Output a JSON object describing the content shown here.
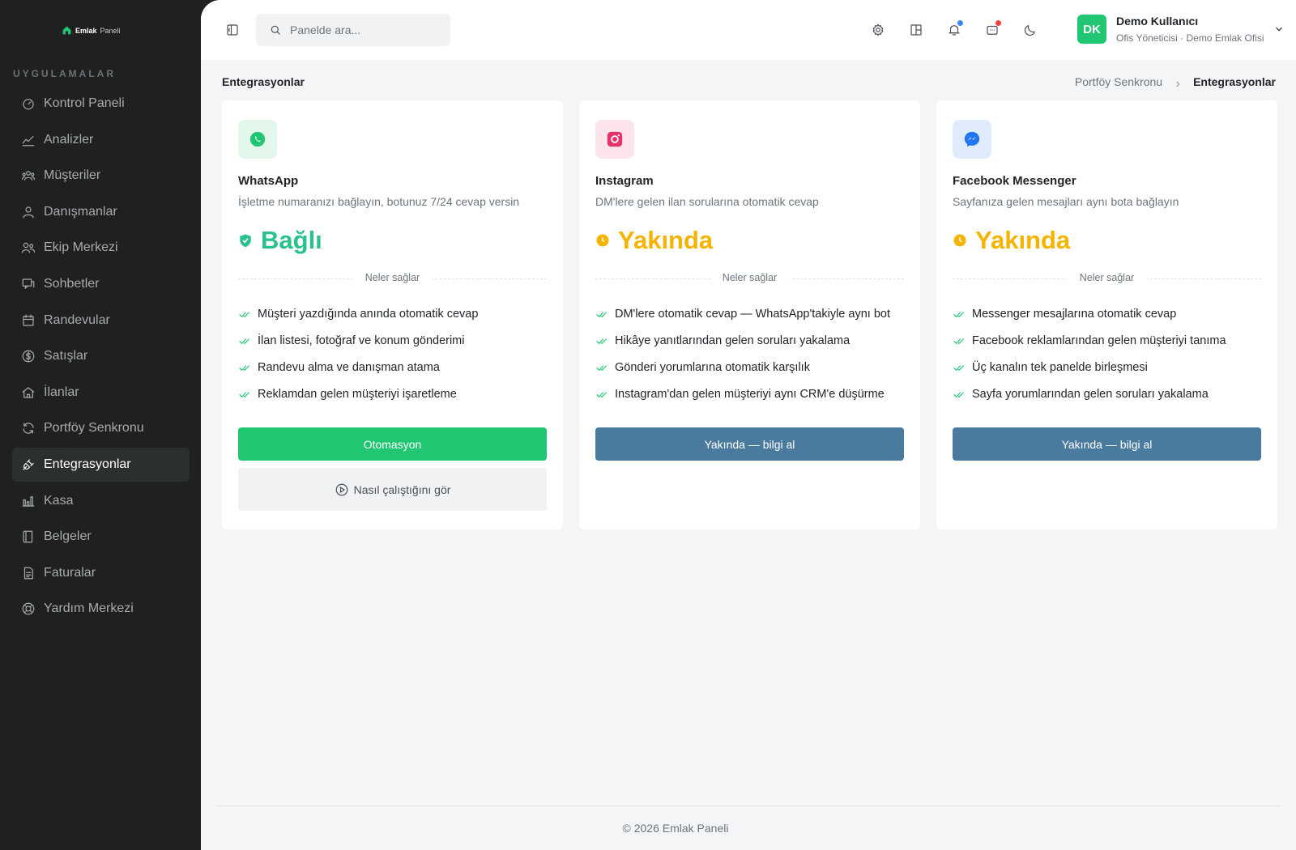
{
  "brand": {
    "name": "Emlak",
    "sub": "Paneli"
  },
  "sidebar": {
    "section_title": "UYGULAMALAR",
    "items": [
      {
        "label": "Kontrol Paneli",
        "icon": "dashboard-icon"
      },
      {
        "label": "Analizler",
        "icon": "chart-line-icon"
      },
      {
        "label": "Müşteriler",
        "icon": "users-icon"
      },
      {
        "label": "Danışmanlar",
        "icon": "user-icon"
      },
      {
        "label": "Ekip Merkezi",
        "icon": "team-icon"
      },
      {
        "label": "Sohbetler",
        "icon": "chat-icon"
      },
      {
        "label": "Randevular",
        "icon": "calendar-icon"
      },
      {
        "label": "Satışlar",
        "icon": "dollar-icon"
      },
      {
        "label": "İlanlar",
        "icon": "home-icon"
      },
      {
        "label": "Portföy Senkronu",
        "icon": "sync-icon"
      },
      {
        "label": "Entegrasyonlar",
        "icon": "plug-icon",
        "active": true
      },
      {
        "label": "Kasa",
        "icon": "bar-chart-icon"
      },
      {
        "label": "Belgeler",
        "icon": "book-icon"
      },
      {
        "label": "Faturalar",
        "icon": "invoice-icon"
      },
      {
        "label": "Yardım Merkezi",
        "icon": "lifebuoy-icon"
      }
    ]
  },
  "topbar": {
    "search_placeholder": "Panelde ara...",
    "user": {
      "initials": "DK",
      "name": "Demo Kullanıcı",
      "role": "Ofis Yöneticisi · Demo Emlak Ofisi"
    }
  },
  "page": {
    "title": "Entegrasyonlar",
    "breadcrumb": {
      "parent": "Portföy Senkronu",
      "current": "Entegrasyonlar"
    }
  },
  "colors": {
    "green": "#20c672",
    "amber": "#f5b400",
    "blue_button": "#4a7a9e"
  },
  "cards": [
    {
      "name": "WhatsApp",
      "desc": "İşletme numaranızı bağlayın, botunuz 7/24 cevap versin",
      "status": "Bağlı",
      "divider": "Neler sağlar",
      "features": [
        "Müşteri yazdığında anında otomatik cevap",
        "İlan listesi, fotoğraf ve konum gönderimi",
        "Randevu alma ve danışman atama",
        "Reklamdan gelen müşteriyi işaretleme"
      ],
      "button": "Otomasyon",
      "secondary_button": "Nasıl çalıştığını gör"
    },
    {
      "name": "Instagram",
      "desc": "DM'lere gelen ilan sorularına otomatik cevap",
      "status": "Yakında",
      "divider": "Neler sağlar",
      "features": [
        "DM'lere otomatik cevap — WhatsApp'takiyle aynı bot",
        "Hikâye yanıtlarından gelen soruları yakalama",
        "Gönderi yorumlarına otomatik karşılık",
        "Instagram'dan gelen müşteriyi aynı CRM'e düşürme"
      ],
      "button": "Yakında — bilgi al"
    },
    {
      "name": "Facebook Messenger",
      "desc": "Sayfanıza gelen mesajları aynı bota bağlayın",
      "status": "Yakında",
      "divider": "Neler sağlar",
      "features": [
        "Messenger mesajlarına otomatik cevap",
        "Facebook reklamlarından gelen müşteriyi tanıma",
        "Üç kanalın tek panelde birleşmesi",
        "Sayfa yorumlarından gelen soruları yakalama"
      ],
      "button": "Yakında — bilgi al"
    }
  ],
  "footer": "© 2026 Emlak Paneli"
}
